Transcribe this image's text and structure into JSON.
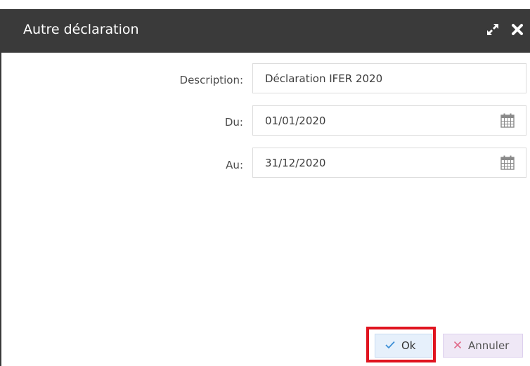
{
  "dialog": {
    "title": "Autre déclaration",
    "icons": {
      "expand": "expand-arrows-icon",
      "close": "close-x-icon",
      "calendar": "calendar-icon",
      "check": "check-icon",
      "cancel": "x-icon"
    }
  },
  "form": {
    "description": {
      "label": "Description:",
      "value": "Déclaration IFER 2020"
    },
    "du": {
      "label": "Du:",
      "value": "01/01/2020"
    },
    "au": {
      "label": "Au:",
      "value": "31/12/2020"
    }
  },
  "buttons": {
    "ok_label": "Ok",
    "cancel_label": "Annuler"
  },
  "colors": {
    "titlebar": "#3a3a3a",
    "ok_bg": "#e6f0fb",
    "cancel_bg": "#efe8f6",
    "highlight": "#e0141f",
    "check_color": "#3d8fd6",
    "cancel_x_color": "#e06a8a"
  }
}
